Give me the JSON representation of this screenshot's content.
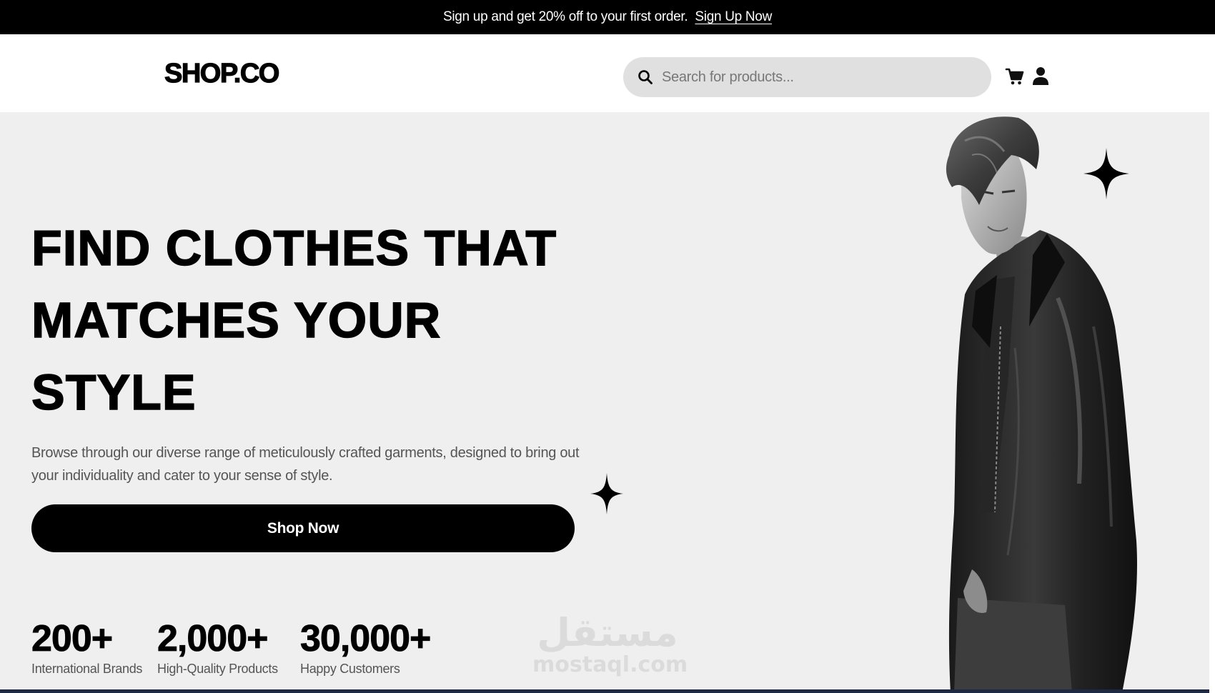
{
  "promo": {
    "text": "Sign up and get 20% off to your first order.",
    "link_label": "Sign Up Now"
  },
  "header": {
    "logo": "SHOP.CO",
    "search_placeholder": "Search for products...",
    "icons": [
      "search-icon",
      "cart-icon",
      "user-icon"
    ]
  },
  "hero": {
    "title_lines": [
      "FIND CLOTHES THAT",
      "MATCHES YOUR",
      "STYLE"
    ],
    "description": "Browse through our diverse range of meticulously crafted garments, designed to bring out your individuality and cater to your sense of style.",
    "button_label": "Shop Now",
    "stats": [
      {
        "value": "200+",
        "label": "International Brands"
      },
      {
        "value": "2,000+",
        "label": "High-Quality Products"
      },
      {
        "value": "30,000+",
        "label": "Happy Customers"
      }
    ]
  },
  "watermark": {
    "arabic": "مستقل",
    "latin": "mostaql.com"
  },
  "colors": {
    "promo_bg": "#000000",
    "hero_bg": "#efefef",
    "button_bg": "#000000",
    "search_bg": "#e0e0e0",
    "text_muted": "#555555"
  }
}
